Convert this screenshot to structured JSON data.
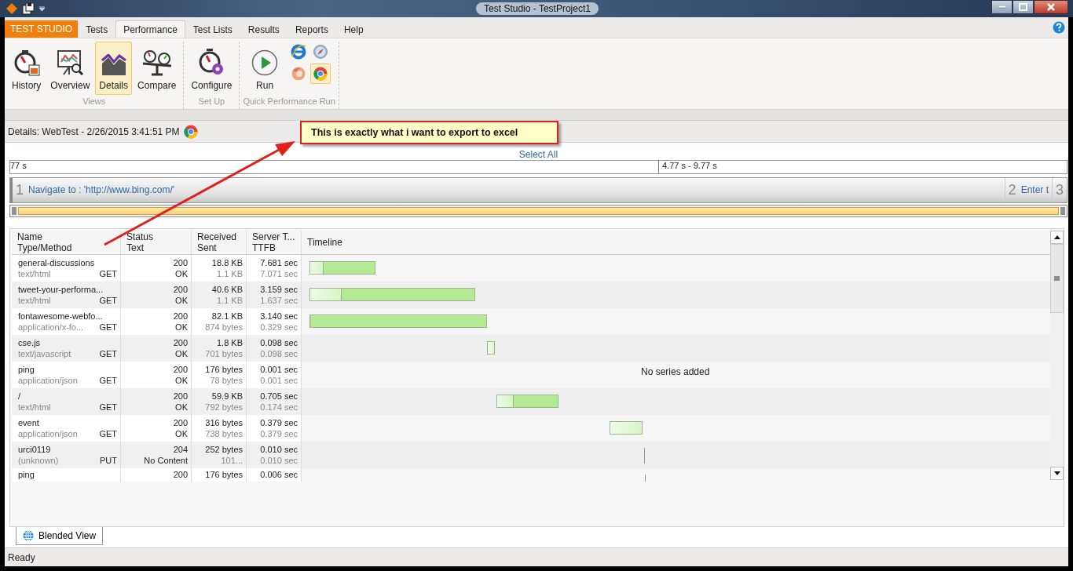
{
  "window": {
    "title": "Test Studio - TestProject1"
  },
  "app_button": "TEST STUDIO",
  "tabs": [
    {
      "label": "Tests",
      "selected": false
    },
    {
      "label": "Performance",
      "selected": true
    },
    {
      "label": "Test Lists",
      "selected": false
    },
    {
      "label": "Results",
      "selected": false
    },
    {
      "label": "Reports",
      "selected": false
    },
    {
      "label": "Help",
      "selected": false
    }
  ],
  "ribbon": {
    "groups": [
      {
        "label": "Views",
        "buttons": [
          {
            "kind": "history",
            "label": "History",
            "selected": false
          },
          {
            "kind": "overview",
            "label": "Overview",
            "selected": false
          },
          {
            "kind": "details",
            "label": "Details",
            "selected": true
          },
          {
            "kind": "compare",
            "label": "Compare",
            "selected": false
          }
        ]
      },
      {
        "label": "Set Up",
        "buttons": [
          {
            "kind": "configure",
            "label": "Configure",
            "selected": false
          }
        ]
      },
      {
        "label": "Quick Performance Run",
        "buttons": [
          {
            "kind": "run",
            "label": "Run",
            "selected": false
          }
        ],
        "browsers": [
          {
            "kind": "ie",
            "selected": false
          },
          {
            "kind": "safari",
            "selected": false
          },
          {
            "kind": "firefox",
            "selected": false
          },
          {
            "kind": "chrome",
            "selected": true
          }
        ]
      }
    ]
  },
  "details_header": {
    "title": "Details: WebTest - 2/26/2015 3:41:51 PM"
  },
  "annotation": {
    "text": "This is exactly what i want to export to excel"
  },
  "select_all": "Select All",
  "time_ruler": {
    "left": "77 s",
    "range": "4.77 s - 9.77 s"
  },
  "steps": [
    {
      "number": "1",
      "label": "Navigate to : 'http://www.bing.com/'",
      "selected": true
    },
    {
      "number": "2",
      "label": "Enter t",
      "selected": false
    },
    {
      "number": "3",
      "selected": false
    }
  ],
  "table": {
    "columns": [
      {
        "top": "Name",
        "bottom": "Type/Method"
      },
      {
        "top": "Status",
        "bottom": "Text"
      },
      {
        "top": "Received",
        "bottom": "Sent"
      },
      {
        "top": "Server T...",
        "bottom": "TTFB"
      },
      {
        "top": "Timeline"
      }
    ],
    "rows": [
      {
        "name": "general-discussions",
        "type": "text/html",
        "method": "GET",
        "status": "200",
        "status_text": "OK",
        "received": "18.8 KB",
        "sent": "1.1 KB",
        "server": "7.681 sec",
        "ttfb": "7.071 sec"
      },
      {
        "name": "tweet-your-performa...",
        "type": "text/html",
        "method": "GET",
        "status": "200",
        "status_text": "OK",
        "received": "40.6 KB",
        "sent": "1.1 KB",
        "server": "3.159 sec",
        "ttfb": "1.637 sec"
      },
      {
        "name": "fontawesome-webfo...",
        "type": "application/x-fo...",
        "method": "GET",
        "status": "200",
        "status_text": "OK",
        "received": "82.1 KB",
        "sent": "874 bytes",
        "server": "3.140 sec",
        "ttfb": "0.329 sec"
      },
      {
        "name": "cse.js",
        "type": "text/javascript",
        "method": "GET",
        "status": "200",
        "status_text": "OK",
        "received": "1.8 KB",
        "sent": "701 bytes",
        "server": "0.098 sec",
        "ttfb": "0.098 sec"
      },
      {
        "name": "ping",
        "type": "application/json",
        "method": "GET",
        "status": "200",
        "status_text": "OK",
        "received": "176 bytes",
        "sent": "78 bytes",
        "server": "0.001 sec",
        "ttfb": "0.001 sec"
      },
      {
        "name": "/",
        "type": "text/html",
        "method": "GET",
        "status": "200",
        "status_text": "OK",
        "received": "59.9 KB",
        "sent": "792 bytes",
        "server": "0.705 sec",
        "ttfb": "0.174 sec"
      },
      {
        "name": "event",
        "type": "application/json",
        "method": "GET",
        "status": "200",
        "status_text": "OK",
        "received": "316 bytes",
        "sent": "738 bytes",
        "server": "0.379 sec",
        "ttfb": "0.379 sec"
      },
      {
        "name": "urci0119",
        "type": "(unknown)",
        "method": "PUT",
        "status": "204",
        "status_text": "No Content",
        "received": "252 bytes",
        "sent": "101...",
        "server": "0.010 sec",
        "ttfb": "0.010 sec"
      },
      {
        "name": "ping",
        "status": "200",
        "received": "176 bytes",
        "server": "0.006 sec"
      }
    ],
    "timeline_message": "No series added"
  },
  "bottom_tabs": [
    {
      "label": "Blended View",
      "selected": true
    }
  ],
  "status_bar": "Ready"
}
